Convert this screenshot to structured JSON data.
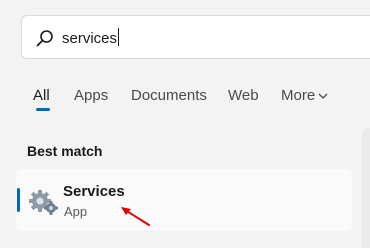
{
  "search": {
    "query": "services"
  },
  "tabs": [
    {
      "label": "All",
      "active": true
    },
    {
      "label": "Apps"
    },
    {
      "label": "Documents"
    },
    {
      "label": "Web"
    },
    {
      "label": "More"
    }
  ],
  "best_match": {
    "title": "Best match",
    "item": {
      "name": "Services",
      "type": "App",
      "icon": "services-gear-icon"
    }
  },
  "colors": {
    "accent": "#0067c0",
    "annotation_arrow": "#e00000"
  }
}
